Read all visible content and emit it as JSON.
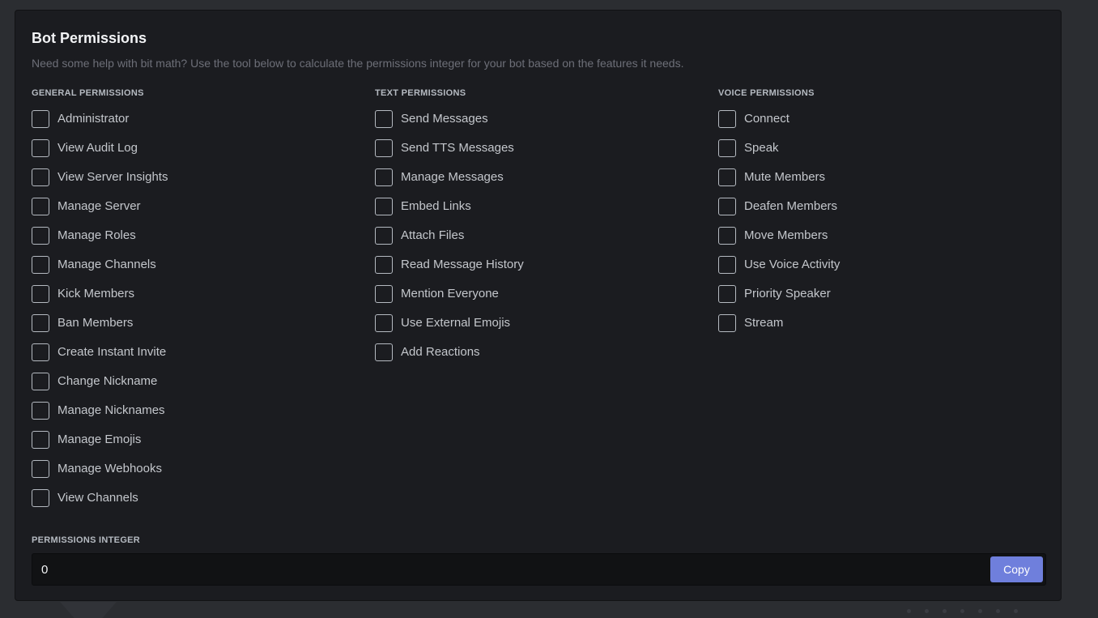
{
  "panel": {
    "title": "Bot Permissions",
    "subtitle": "Need some help with bit math? Use the tool below to calculate the permissions integer for your bot based on the features it needs."
  },
  "columns": {
    "general": {
      "header": "GENERAL PERMISSIONS",
      "items": [
        {
          "label": "Administrator",
          "checked": false
        },
        {
          "label": "View Audit Log",
          "checked": false
        },
        {
          "label": "View Server Insights",
          "checked": false
        },
        {
          "label": "Manage Server",
          "checked": false
        },
        {
          "label": "Manage Roles",
          "checked": false
        },
        {
          "label": "Manage Channels",
          "checked": false
        },
        {
          "label": "Kick Members",
          "checked": false
        },
        {
          "label": "Ban Members",
          "checked": false
        },
        {
          "label": "Create Instant Invite",
          "checked": false
        },
        {
          "label": "Change Nickname",
          "checked": false
        },
        {
          "label": "Manage Nicknames",
          "checked": false
        },
        {
          "label": "Manage Emojis",
          "checked": false
        },
        {
          "label": "Manage Webhooks",
          "checked": false
        },
        {
          "label": "View Channels",
          "checked": false
        }
      ]
    },
    "text": {
      "header": "TEXT PERMISSIONS",
      "items": [
        {
          "label": "Send Messages",
          "checked": false
        },
        {
          "label": "Send TTS Messages",
          "checked": false
        },
        {
          "label": "Manage Messages",
          "checked": false
        },
        {
          "label": "Embed Links",
          "checked": false
        },
        {
          "label": "Attach Files",
          "checked": false
        },
        {
          "label": "Read Message History",
          "checked": false
        },
        {
          "label": "Mention Everyone",
          "checked": false
        },
        {
          "label": "Use External Emojis",
          "checked": false
        },
        {
          "label": "Add Reactions",
          "checked": false
        }
      ]
    },
    "voice": {
      "header": "VOICE PERMISSIONS",
      "items": [
        {
          "label": "Connect",
          "checked": false
        },
        {
          "label": "Speak",
          "checked": false
        },
        {
          "label": "Mute Members",
          "checked": false
        },
        {
          "label": "Deafen Members",
          "checked": false
        },
        {
          "label": "Move Members",
          "checked": false
        },
        {
          "label": "Use Voice Activity",
          "checked": false
        },
        {
          "label": "Priority Speaker",
          "checked": false
        },
        {
          "label": "Stream",
          "checked": false
        }
      ]
    }
  },
  "integer": {
    "label": "PERMISSIONS INTEGER",
    "value": "0",
    "copy_label": "Copy"
  },
  "colors": {
    "panel_bg": "#1b1c20",
    "page_bg": "#2b2d31",
    "accent": "#6f7fdc",
    "checkbox_border": "#b5bac1"
  }
}
